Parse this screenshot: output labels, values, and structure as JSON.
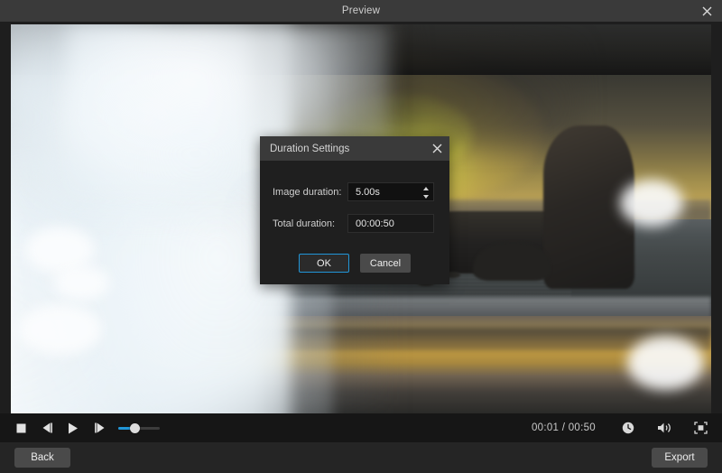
{
  "window": {
    "title": "Preview",
    "close_icon": "close-icon"
  },
  "preview": {
    "description": "Coastal sunset seascape with rock silhouettes and white fog transition overlay"
  },
  "controls": {
    "stop_icon": "stop-icon",
    "prev_frame_icon": "previous-frame-icon",
    "play_icon": "play-icon",
    "next_frame_icon": "next-frame-icon",
    "volume_value": 32,
    "time_display": "00:01 / 00:50",
    "current_time": "00:01",
    "total_time": "00:50",
    "clock_icon": "clock-icon",
    "audio_icon": "speaker-icon",
    "fullscreen_icon": "fullscreen-icon"
  },
  "footer": {
    "back_label": "Back",
    "export_label": "Export"
  },
  "dialog": {
    "title": "Duration Settings",
    "close_icon": "close-icon",
    "image_duration_label": "Image duration:",
    "image_duration_value": "5.00s",
    "total_duration_label": "Total duration:",
    "total_duration_value": "00:00:50",
    "ok_label": "OK",
    "cancel_label": "Cancel"
  },
  "colors": {
    "accent": "#2196d8",
    "titlebar": "#3a3a3a",
    "dialog_body": "#1f1f1f",
    "footer": "#252525",
    "controls_bar": "#161616"
  }
}
